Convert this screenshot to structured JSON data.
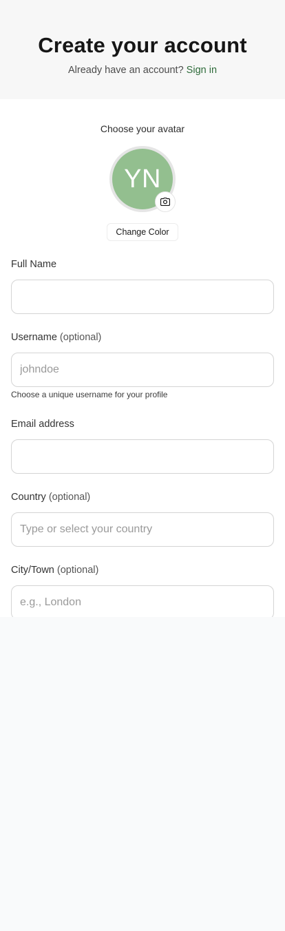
{
  "header": {
    "title": "Create your account",
    "subtitle_text": "Already have an account?",
    "signin_link": "Sign in"
  },
  "avatar": {
    "label": "Choose your avatar",
    "initials": "YN",
    "color": "#93bf8f",
    "camera_icon": "camera-icon",
    "change_color_label": "Change Color"
  },
  "form": {
    "full_name": {
      "label": "Full Name",
      "value": "",
      "placeholder": ""
    },
    "username": {
      "label": "Username",
      "optional": "(optional)",
      "value": "",
      "placeholder": "johndoe",
      "hint": "Choose a unique username for your profile"
    },
    "email": {
      "label": "Email address",
      "value": "",
      "placeholder": ""
    },
    "country": {
      "label": "Country",
      "optional": "(optional)",
      "value": "",
      "placeholder": "Type or select your country"
    },
    "city": {
      "label": "City/Town",
      "optional": "(optional)",
      "value": "",
      "placeholder": "e.g., London"
    }
  },
  "colors": {
    "link": "#2e6b3a",
    "background": "#f9fafb",
    "card": "#ffffff"
  }
}
